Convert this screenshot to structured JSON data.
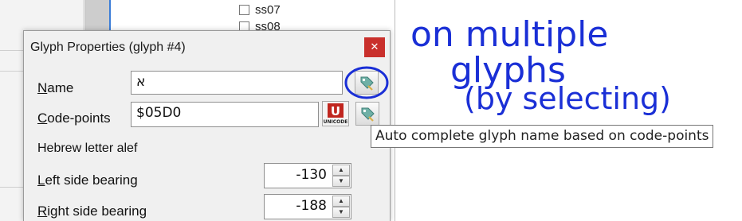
{
  "background_list": {
    "items": [
      "ss07",
      "ss08"
    ]
  },
  "dialog": {
    "title": "Glyph Properties (glyph #4)",
    "close_glyph": "✕",
    "name_label_access": "N",
    "name_label_rest": "ame",
    "name_value": "א",
    "codepoints_label_access": "C",
    "codepoints_label_rest": "ode-points",
    "codepoints_value": "$05D0",
    "unicode_logo_top": "U",
    "unicode_logo_bottom": "UNICODE",
    "description": "Hebrew letter alef",
    "lsb_label_access": "L",
    "lsb_label_rest": "eft side bearing",
    "lsb_value": "-130",
    "rsb_label_access": "R",
    "rsb_label_rest": "ight side bearing",
    "rsb_value": "-188"
  },
  "tooltip": {
    "text": "Auto complete glyph name based on code-points"
  },
  "annotation": {
    "color": "#1a2fd6",
    "lines": [
      "on multiple",
      "glyphs",
      "(by selecting)"
    ]
  },
  "colors": {
    "close_button": "#c9302c",
    "selection_blue": "#3b7dd8"
  }
}
